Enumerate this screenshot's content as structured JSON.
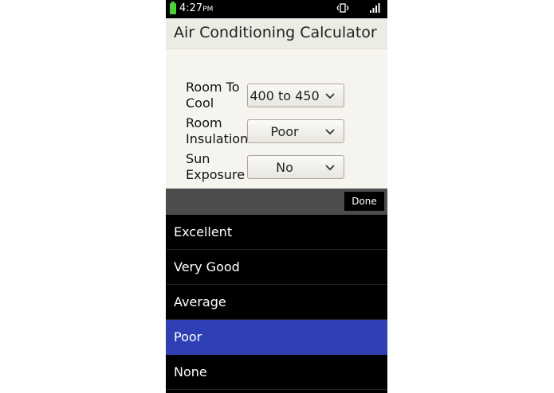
{
  "status_bar": {
    "time": "4:27",
    "ampm": "PM",
    "icons": [
      "battery-icon",
      "vibrate-icon",
      "signal-icon"
    ]
  },
  "app": {
    "title": "Air Conditioning Calculator"
  },
  "form": {
    "room_to_cool": {
      "label": "Room To Cool",
      "value": "400 to 450"
    },
    "room_insulation": {
      "label": "Room Insulation",
      "value": "Poor"
    },
    "sun_exposure": {
      "label": "Sun Exposure",
      "value": "No"
    }
  },
  "picker": {
    "done_label": "Done",
    "options": [
      "Excellent",
      "Very Good",
      "Average",
      "Poor",
      "None"
    ],
    "selected_index": 3,
    "selected_color": "#2f3fb4"
  }
}
